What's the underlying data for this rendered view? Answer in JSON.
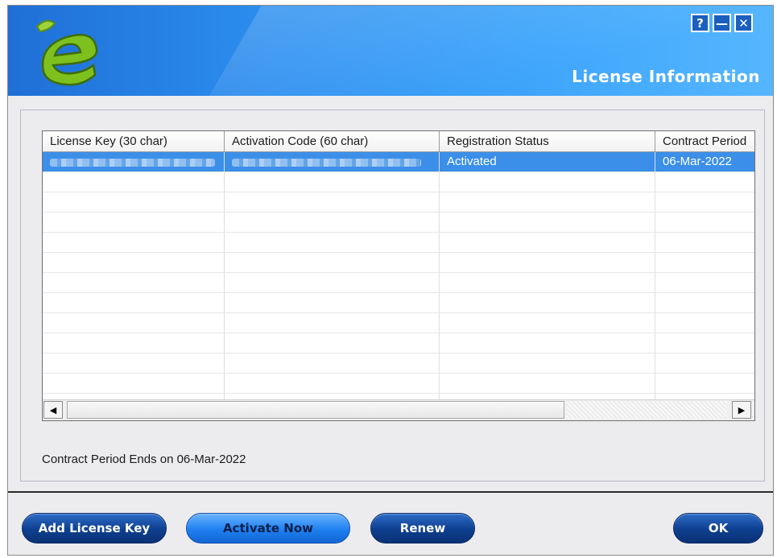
{
  "window": {
    "title": "License Information",
    "help_symbol": "?",
    "minimize_symbol": "—",
    "close_symbol": "✕"
  },
  "table": {
    "columns": [
      "License Key (30 char)",
      "Activation Code (60 char)",
      "Registration Status",
      "Contract Period"
    ],
    "rows": [
      {
        "license_key": "",
        "activation_code": "",
        "registration_status": "Activated",
        "contract_period": "06-Mar-2022"
      }
    ]
  },
  "scrollbar": {
    "left_symbol": "◀",
    "right_symbol": "▶"
  },
  "contract_text": "Contract Period Ends on 06-Mar-2022",
  "buttons": {
    "add_license_key": "Add License Key",
    "activate_now": "Activate Now",
    "renew": "Renew",
    "ok": "OK"
  },
  "colors": {
    "header_blue": "#2c8ff0",
    "selection": "#3b8fe8",
    "button_dark": "#0e3f8f",
    "button_active": "#1f80f0",
    "logo_green": "#7ec11e"
  },
  "icons": {
    "logo": "green-e-logo"
  }
}
